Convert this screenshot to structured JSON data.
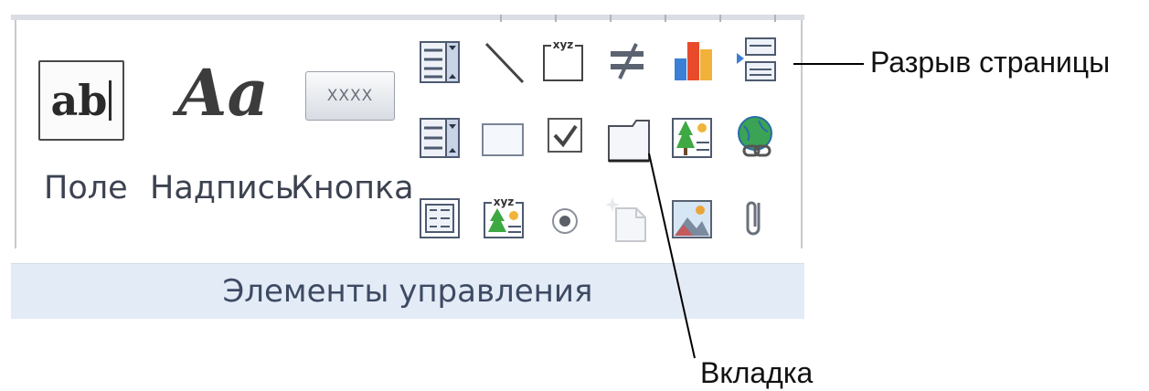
{
  "ribbon": {
    "group_label": "Элементы управления",
    "buttons": {
      "field": {
        "label": "Поле",
        "glyph": "ab"
      },
      "label": {
        "label": "Надпись",
        "glyph": "Aa"
      },
      "button": {
        "label": "Кнопка",
        "glyph": "XXXX"
      }
    },
    "small_icons": [
      [
        "combo-box-icon",
        "line-icon",
        "unbound-object-frame-icon",
        "toggle-button-icon",
        "chart-icon",
        "page-break-icon"
      ],
      [
        "list-box-icon",
        "rectangle-icon",
        "check-box-icon",
        "tab-control-icon",
        "bound-object-frame-icon",
        "hyperlink-icon"
      ],
      [
        "subform-icon",
        "option-group-icon",
        "option-button-icon",
        "insert-page-icon",
        "image-icon",
        "attachment-icon"
      ]
    ],
    "icon_texts": {
      "xyz": "xyz"
    }
  },
  "callouts": {
    "page_break": "Разрыв страницы",
    "tab": "Вкладка"
  }
}
